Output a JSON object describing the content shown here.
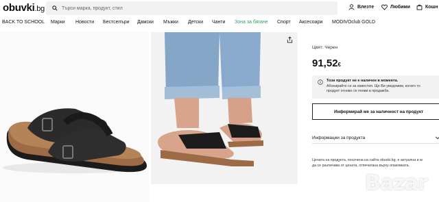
{
  "header": {
    "logo": "obuvki",
    "logo_suffix": ".bg",
    "search_placeholder": "Търси марка, продукт, стил",
    "login_label": "Влезте",
    "favorites_label": "Любими",
    "cart_label": "Кошн"
  },
  "nav": {
    "items": [
      "BACK TO SCHOOL",
      "Марки",
      "Новости",
      "Бестселъри",
      "Дамски",
      "Мъжки",
      "Детски",
      "Чанти",
      "Зона за бягане",
      "Спорт",
      "Аксесоари",
      "MODIVOclub GOLD"
    ]
  },
  "product": {
    "color_label": "Цвят: Черен",
    "price": "91,52",
    "currency": "€",
    "notice_title": "Този продукт не е наличен в момента.",
    "notice_line1": "Абонирайте се за известия. Ще Ви уведомим, когато то",
    "notice_line2": "продукт отново се появи в продажба.",
    "notify_button": "Информирай ме за наличност на продукт",
    "info_label": "Информации за продукта",
    "disclaimer_line1": "Цената на продукта, посочена на сайта obuvki.bg, е актуална и м",
    "disclaimer_line2": "да се различава от цената, отпечатана върху опаковката."
  },
  "watermark": "Bazar",
  "colors": {
    "accent_green": "#2e9e5a",
    "notice_bg": "#f2f2f2",
    "search_bg": "#f1f1f1"
  },
  "icons": [
    "search-icon",
    "user-icon",
    "heart-icon",
    "cart-icon",
    "share-icon",
    "info-icon",
    "chevron-down-icon"
  ]
}
